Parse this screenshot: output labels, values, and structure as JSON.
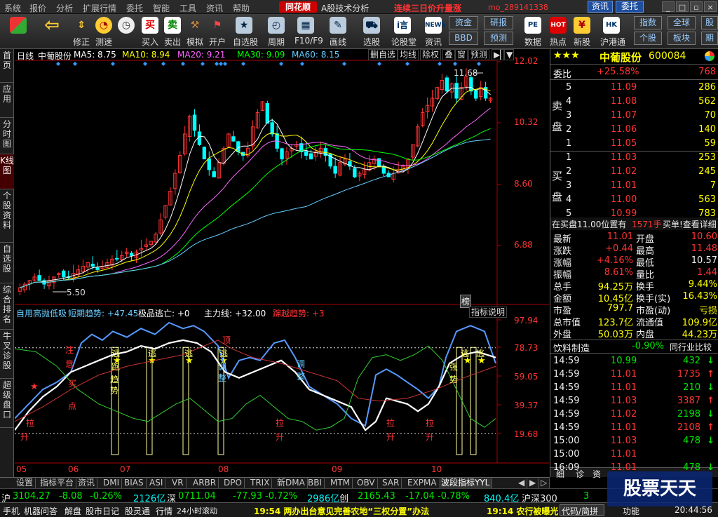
{
  "menu": {
    "items": [
      "系统",
      "报价",
      "分析",
      "扩展行情",
      "委托",
      "智能",
      "工具",
      "资讯",
      "帮助"
    ],
    "logo": "同花顺",
    "subtitle": "A股技术分析",
    "marquee": "连续三日价升量涨",
    "user": "mo_289141338",
    "btn_news": "资讯",
    "btn_trade": "委托"
  },
  "toolbar": {
    "buttons": [
      {
        "label": "",
        "icon": "layout-icon"
      },
      {
        "label": "",
        "icon": "back-arrow-icon"
      },
      {
        "label": "修正",
        "icon": "updown-arrow-icon"
      },
      {
        "label": "测速",
        "icon": "speedometer-icon"
      },
      {
        "label": "买入",
        "icon": "buy-icon",
        "glyph": "买"
      },
      {
        "label": "卖出",
        "icon": "sell-icon",
        "glyph": "卖"
      },
      {
        "label": "模拟",
        "icon": "hammer-icon"
      },
      {
        "label": "开户",
        "icon": "flag-icon"
      },
      {
        "label": "自选股",
        "icon": "star-icon"
      },
      {
        "label": "周期",
        "icon": "clock-icon"
      },
      {
        "label": "F10/F9",
        "icon": "grid-icon"
      },
      {
        "label": "画线",
        "icon": "pencil-icon"
      },
      {
        "label": "选股",
        "icon": "car-icon"
      },
      {
        "label": "论股堂",
        "icon": "ic-icon",
        "glyph": "i言"
      },
      {
        "label": "资讯",
        "icon": "news-icon",
        "glyph": "NEWS"
      },
      {
        "label": "数据",
        "icon": "pe-icon",
        "glyph": "PE"
      },
      {
        "label": "热点",
        "icon": "hot-icon",
        "glyph": "HOT"
      },
      {
        "label": "新股",
        "icon": "money-bag-icon"
      },
      {
        "label": "沪港通",
        "icon": "hk-icon",
        "glyph": "HK"
      }
    ],
    "squares": [
      "资金",
      "研报",
      "BBD",
      "预测",
      "指数",
      "全球",
      "股",
      "个股",
      "板块",
      "期"
    ]
  },
  "sidebar": {
    "items": [
      "首页",
      "应用",
      "分时图",
      "K线图",
      "个股资料",
      "自选股",
      "综合排名",
      "牛叉诊股",
      "超级盘口"
    ]
  },
  "kline": {
    "label": "日线",
    "stock": "中葡股份",
    "ma5": "MA5: 8.75",
    "ma10": "MA10: 8.94",
    "ma20": "MA20: 9.21",
    "ma30": "MA30: 9.09",
    "ma60": "MA60: 8.15",
    "buttons": [
      "删自选",
      "均线",
      "除权",
      "叠",
      "窗",
      "预测"
    ],
    "axis": [
      "12.02",
      "10.32",
      "8.60",
      "6.88"
    ],
    "high_label": "11.68",
    "low_label": "5.50",
    "bang": "榜"
  },
  "indicator": {
    "name": "自用高抛低吸",
    "short": "短期趋势: +47.45",
    "pin": "极品逃亡: +0",
    "main": "主力线: +32.00",
    "cross": "蹿越趋势: +3",
    "explain": "指标说明",
    "axis": [
      "97.94",
      "78.73",
      "59.05",
      "39.37",
      "19.68"
    ],
    "labels": [
      "注",
      "意",
      "买",
      "点",
      "逃",
      "跑",
      "趋",
      "势",
      "逃",
      "逃",
      "逃",
      "调",
      "整",
      "调",
      "整",
      "拉",
      "升",
      "拉",
      "升",
      "拉",
      "升",
      "拉",
      "升",
      "强",
      "势",
      "逃",
      "逃",
      "顶"
    ]
  },
  "xaxis": [
    "05",
    "06",
    "07",
    "08",
    "09",
    "10"
  ],
  "colors": {
    "ma5": "#ffffff",
    "ma10": "#ffff00",
    "ma20": "#ff66ff",
    "ma30": "#00ff00",
    "ma60": "#66ccff",
    "up": "#ff3333",
    "down": "#00ffff"
  },
  "quote": {
    "stars": "★★★",
    "name": "中葡股份",
    "code": "600084",
    "weibi_label": "委比",
    "weibi": "+25.58%",
    "weicha": "768",
    "sell_title": "卖盘",
    "buy_title": "买盘",
    "sells": [
      {
        "n": "5",
        "p": "11.09",
        "v": "286"
      },
      {
        "n": "4",
        "p": "11.08",
        "v": "562"
      },
      {
        "n": "3",
        "p": "11.07",
        "v": "70"
      },
      {
        "n": "2",
        "p": "11.06",
        "v": "140"
      },
      {
        "n": "1",
        "p": "11.05",
        "v": "59"
      }
    ],
    "buys": [
      {
        "n": "1",
        "p": "11.03",
        "v": "253"
      },
      {
        "n": "2",
        "p": "11.02",
        "v": "245"
      },
      {
        "n": "3",
        "p": "11.01",
        "v": "7"
      },
      {
        "n": "4",
        "p": "11.00",
        "v": "563"
      },
      {
        "n": "5",
        "p": "10.99",
        "v": "783"
      }
    ],
    "notice_a": "在买盘11.00位置有",
    "notice_b": "1571手",
    "notice_c": "买单!查看详细",
    "stats": [
      {
        "k1": "最新",
        "v1": "11.01",
        "k2": "开盘",
        "v2": "10.60"
      },
      {
        "k1": "涨跌",
        "v1": "+0.44",
        "k2": "最高",
        "v2": "11.48"
      },
      {
        "k1": "涨幅",
        "v1": "+4.16%",
        "k2": "最低",
        "v2": "10.57"
      },
      {
        "k1": "振幅",
        "v1": "8.61%",
        "k2": "量比",
        "v2": "1.44"
      },
      {
        "k1": "总手",
        "v1": "94.25万",
        "k2": "换手",
        "v2": "9.44%"
      },
      {
        "k1": "金额",
        "v1": "10.45亿",
        "k2": "换手(实)",
        "v2": "16.43%"
      },
      {
        "k1": "市盈",
        "v1": "797.7",
        "k2": "市盈(动)",
        "v2": "亏损"
      },
      {
        "k1": "总市值",
        "v1": "123.7亿",
        "k2": "流通值",
        "v2": "109.9亿"
      },
      {
        "k1": "外盘",
        "v1": "50.03万",
        "k2": "内盘",
        "v2": "44.23万"
      }
    ],
    "industry": "饮料制造",
    "industry_chg": "-0.90%",
    "compare": "同行业比较",
    "ticks": [
      {
        "t": "14:59",
        "p": "10.99",
        "v": "432",
        "d": "down"
      },
      {
        "t": "14:59",
        "p": "11.01",
        "v": "1735",
        "d": "up"
      },
      {
        "t": "14:59",
        "p": "11.01",
        "v": "210",
        "d": "down"
      },
      {
        "t": "14:59",
        "p": "11.03",
        "v": "3387",
        "d": "up"
      },
      {
        "t": "14:59",
        "p": "11.02",
        "v": "2198",
        "d": "down"
      },
      {
        "t": "14:59",
        "p": "11.01",
        "v": "2108",
        "d": "up"
      },
      {
        "t": "15:00",
        "p": "11.03",
        "v": "478",
        "d": "down"
      },
      {
        "t": "15:00",
        "p": "11.01",
        "v": "",
        "d": ""
      },
      {
        "t": "16:09",
        "p": "11.01",
        "v": "478",
        "d": "down"
      }
    ],
    "tabs": [
      "细",
      "诊",
      "资"
    ]
  },
  "bottom_tabs": [
    "设置",
    "指标平台",
    "资讯",
    "DMI",
    "BIAS",
    "ASI",
    "VR",
    "ARBR",
    "DPO",
    "TRIX",
    "新DMA",
    "BBI",
    "MTM",
    "OBV",
    "SAR",
    "EXPMA",
    "波段指标YYL"
  ],
  "index_bar": {
    "sh_label": "沪",
    "sh": "3104.27",
    "sh_chg": "-8.08",
    "sh_pct": "-0.26%",
    "sh_amt": "2126亿",
    "sz_label": "深",
    "sz": "0711.04",
    "sz_chg": "-77.93",
    "sz_pct": "-0.72%",
    "sz_amt": "2986亿",
    "cy_label": "创",
    "cy": "2165.43",
    "cy_chg": "-17.04",
    "cy_pct": "-0.78%",
    "cy_amt": "840.4亿",
    "hs_label": "沪深300",
    "hs": "3"
  },
  "status_bar": {
    "items": [
      "手机",
      "机器问答",
      "解盘",
      "股市日记",
      "股灵通",
      "行情",
      "24小时滚动"
    ],
    "news1": "19:54 两办出台意见完善农地“三权分置”办法",
    "news2": "19:14 农行被曝光",
    "code_label": "代码/简拼",
    "func_label": "功能",
    "clock": "20:44:56"
  },
  "watermark": "股票天天"
}
